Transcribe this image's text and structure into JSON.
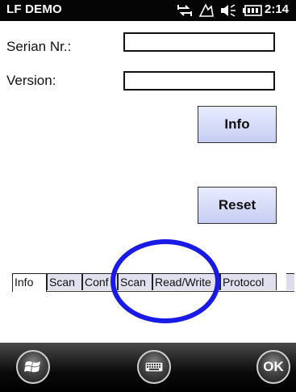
{
  "titlebar": {
    "app_title": "LF DEMO",
    "time": "2:14",
    "status_icons": [
      "sync-icon",
      "signal-icon",
      "volume-icon",
      "battery-icon"
    ]
  },
  "form": {
    "serial_label": "Serian Nr.:",
    "serial_value": "",
    "version_label": "Version:",
    "version_value": "",
    "info_button": "Info",
    "reset_button": "Reset"
  },
  "tabs": [
    {
      "label": "Info",
      "active": true
    },
    {
      "label": "Scan",
      "active": false
    },
    {
      "label": "Conf",
      "active": false
    },
    {
      "label": "Scan",
      "active": false
    },
    {
      "label": "Read/Write",
      "active": false
    },
    {
      "label": "Protocol",
      "active": false
    }
  ],
  "bottombar": {
    "start_icon": "windows-start-icon",
    "keyboard_icon": "keyboard-icon",
    "ok_label": "OK"
  },
  "colors": {
    "titlebar_bg": "#050505",
    "button_gradient_top": "#e9ecff",
    "button_gradient_bottom": "#c6cdf2",
    "annotation_circle": "#1a1ae6"
  }
}
